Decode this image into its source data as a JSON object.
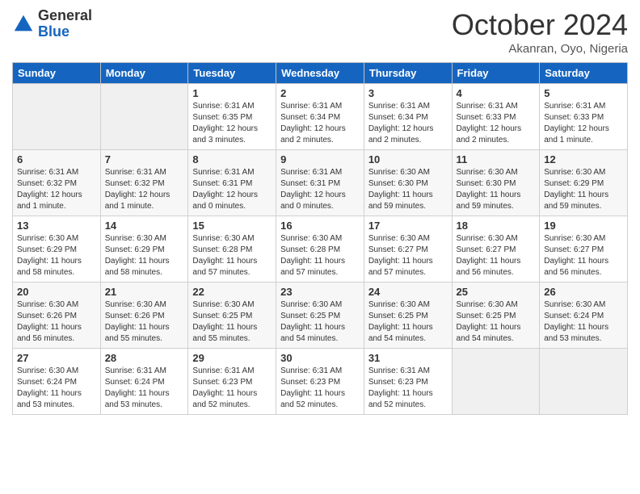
{
  "logo": {
    "general": "General",
    "blue": "Blue"
  },
  "header": {
    "month": "October 2024",
    "location": "Akanran, Oyo, Nigeria"
  },
  "weekdays": [
    "Sunday",
    "Monday",
    "Tuesday",
    "Wednesday",
    "Thursday",
    "Friday",
    "Saturday"
  ],
  "weeks": [
    [
      {
        "day": "",
        "info": ""
      },
      {
        "day": "",
        "info": ""
      },
      {
        "day": "1",
        "info": "Sunrise: 6:31 AM\nSunset: 6:35 PM\nDaylight: 12 hours and 3 minutes."
      },
      {
        "day": "2",
        "info": "Sunrise: 6:31 AM\nSunset: 6:34 PM\nDaylight: 12 hours and 2 minutes."
      },
      {
        "day": "3",
        "info": "Sunrise: 6:31 AM\nSunset: 6:34 PM\nDaylight: 12 hours and 2 minutes."
      },
      {
        "day": "4",
        "info": "Sunrise: 6:31 AM\nSunset: 6:33 PM\nDaylight: 12 hours and 2 minutes."
      },
      {
        "day": "5",
        "info": "Sunrise: 6:31 AM\nSunset: 6:33 PM\nDaylight: 12 hours and 1 minute."
      }
    ],
    [
      {
        "day": "6",
        "info": "Sunrise: 6:31 AM\nSunset: 6:32 PM\nDaylight: 12 hours and 1 minute."
      },
      {
        "day": "7",
        "info": "Sunrise: 6:31 AM\nSunset: 6:32 PM\nDaylight: 12 hours and 1 minute."
      },
      {
        "day": "8",
        "info": "Sunrise: 6:31 AM\nSunset: 6:31 PM\nDaylight: 12 hours and 0 minutes."
      },
      {
        "day": "9",
        "info": "Sunrise: 6:31 AM\nSunset: 6:31 PM\nDaylight: 12 hours and 0 minutes."
      },
      {
        "day": "10",
        "info": "Sunrise: 6:30 AM\nSunset: 6:30 PM\nDaylight: 11 hours and 59 minutes."
      },
      {
        "day": "11",
        "info": "Sunrise: 6:30 AM\nSunset: 6:30 PM\nDaylight: 11 hours and 59 minutes."
      },
      {
        "day": "12",
        "info": "Sunrise: 6:30 AM\nSunset: 6:29 PM\nDaylight: 11 hours and 59 minutes."
      }
    ],
    [
      {
        "day": "13",
        "info": "Sunrise: 6:30 AM\nSunset: 6:29 PM\nDaylight: 11 hours and 58 minutes."
      },
      {
        "day": "14",
        "info": "Sunrise: 6:30 AM\nSunset: 6:29 PM\nDaylight: 11 hours and 58 minutes."
      },
      {
        "day": "15",
        "info": "Sunrise: 6:30 AM\nSunset: 6:28 PM\nDaylight: 11 hours and 57 minutes."
      },
      {
        "day": "16",
        "info": "Sunrise: 6:30 AM\nSunset: 6:28 PM\nDaylight: 11 hours and 57 minutes."
      },
      {
        "day": "17",
        "info": "Sunrise: 6:30 AM\nSunset: 6:27 PM\nDaylight: 11 hours and 57 minutes."
      },
      {
        "day": "18",
        "info": "Sunrise: 6:30 AM\nSunset: 6:27 PM\nDaylight: 11 hours and 56 minutes."
      },
      {
        "day": "19",
        "info": "Sunrise: 6:30 AM\nSunset: 6:27 PM\nDaylight: 11 hours and 56 minutes."
      }
    ],
    [
      {
        "day": "20",
        "info": "Sunrise: 6:30 AM\nSunset: 6:26 PM\nDaylight: 11 hours and 56 minutes."
      },
      {
        "day": "21",
        "info": "Sunrise: 6:30 AM\nSunset: 6:26 PM\nDaylight: 11 hours and 55 minutes."
      },
      {
        "day": "22",
        "info": "Sunrise: 6:30 AM\nSunset: 6:25 PM\nDaylight: 11 hours and 55 minutes."
      },
      {
        "day": "23",
        "info": "Sunrise: 6:30 AM\nSunset: 6:25 PM\nDaylight: 11 hours and 54 minutes."
      },
      {
        "day": "24",
        "info": "Sunrise: 6:30 AM\nSunset: 6:25 PM\nDaylight: 11 hours and 54 minutes."
      },
      {
        "day": "25",
        "info": "Sunrise: 6:30 AM\nSunset: 6:25 PM\nDaylight: 11 hours and 54 minutes."
      },
      {
        "day": "26",
        "info": "Sunrise: 6:30 AM\nSunset: 6:24 PM\nDaylight: 11 hours and 53 minutes."
      }
    ],
    [
      {
        "day": "27",
        "info": "Sunrise: 6:30 AM\nSunset: 6:24 PM\nDaylight: 11 hours and 53 minutes."
      },
      {
        "day": "28",
        "info": "Sunrise: 6:31 AM\nSunset: 6:24 PM\nDaylight: 11 hours and 53 minutes."
      },
      {
        "day": "29",
        "info": "Sunrise: 6:31 AM\nSunset: 6:23 PM\nDaylight: 11 hours and 52 minutes."
      },
      {
        "day": "30",
        "info": "Sunrise: 6:31 AM\nSunset: 6:23 PM\nDaylight: 11 hours and 52 minutes."
      },
      {
        "day": "31",
        "info": "Sunrise: 6:31 AM\nSunset: 6:23 PM\nDaylight: 11 hours and 52 minutes."
      },
      {
        "day": "",
        "info": ""
      },
      {
        "day": "",
        "info": ""
      }
    ]
  ]
}
